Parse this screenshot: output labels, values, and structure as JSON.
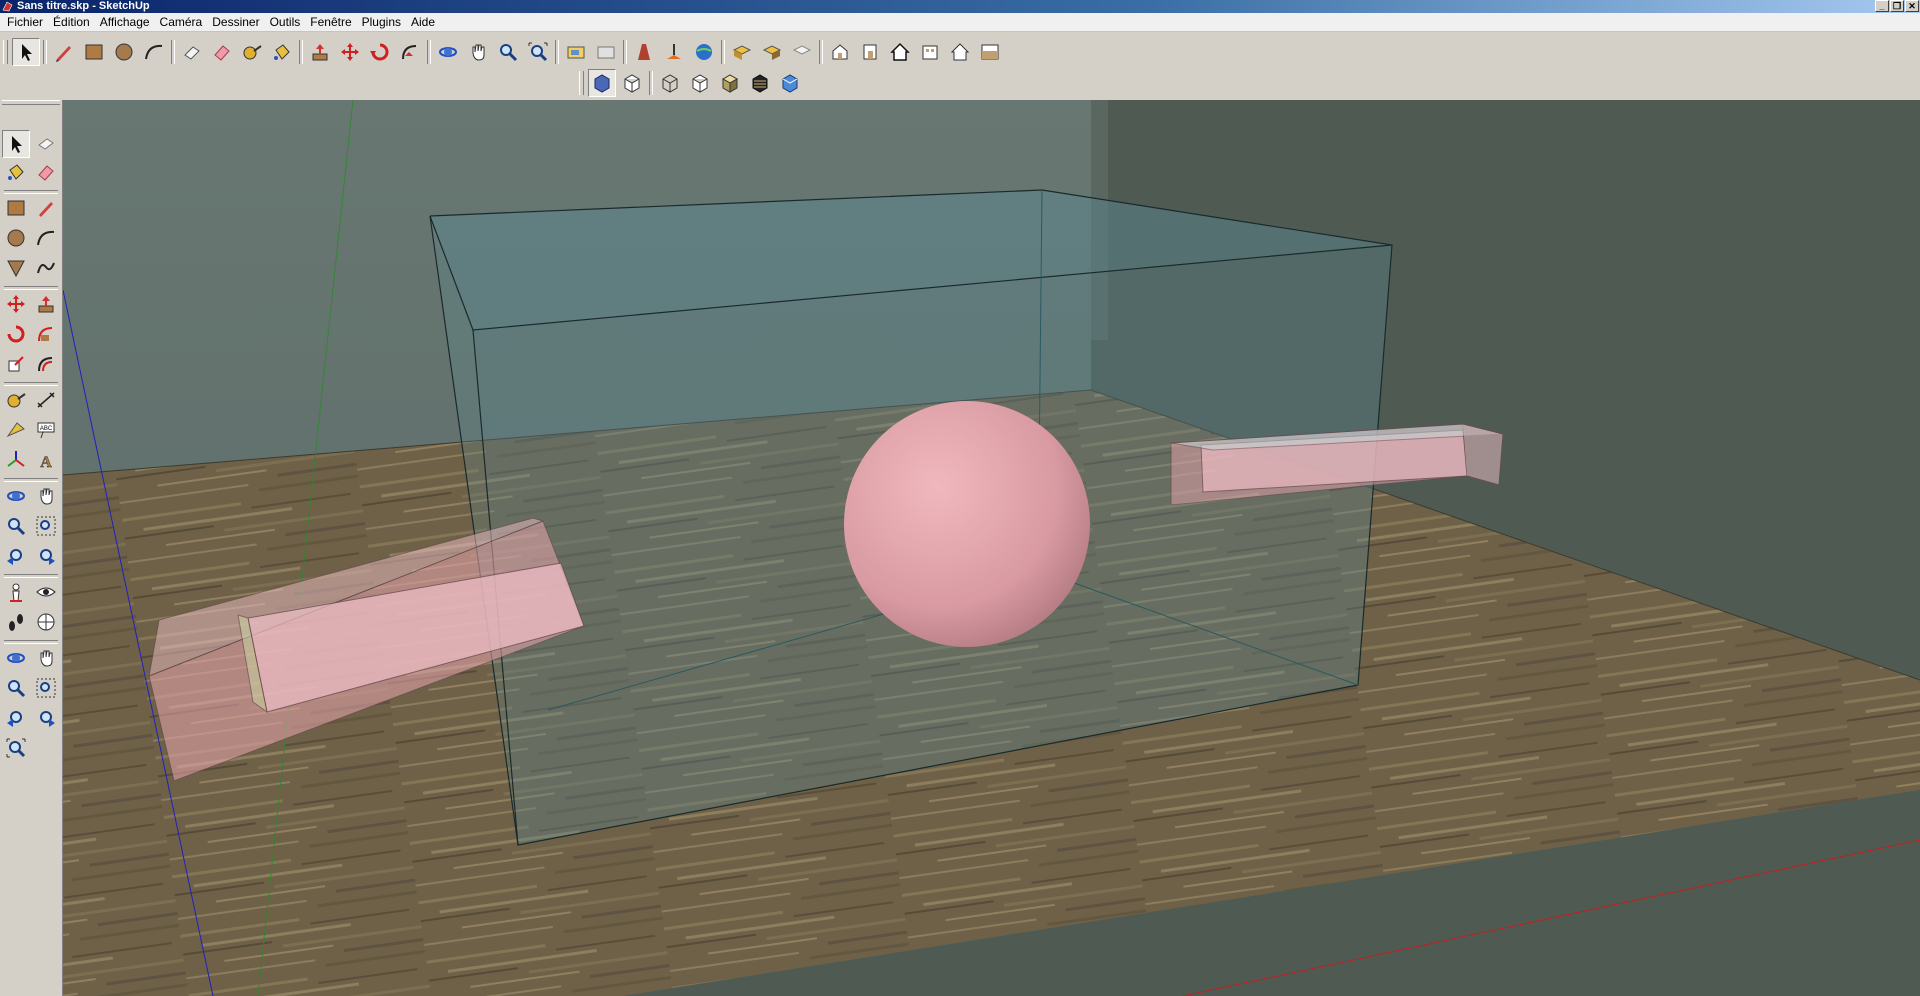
{
  "window": {
    "title": "Sans titre.skp - SketchUp",
    "app_icon": "sketchup-icon",
    "controls": [
      "minimize-icon",
      "restore-icon",
      "close-icon"
    ]
  },
  "menu": {
    "items": [
      "Fichier",
      "Édition",
      "Affichage",
      "Caméra",
      "Dessiner",
      "Outils",
      "Fenêtre",
      "Plugins",
      "Aide"
    ]
  },
  "toolbars": {
    "main": [
      "select-icon",
      "pencil-icon",
      "rectangle-icon",
      "circle-icon",
      "arc-icon",
      "eraser-icon",
      "eraser-pink-icon",
      "tape-measure-icon",
      "paint-bucket-icon",
      "push-pull-icon",
      "move-icon",
      "rotate-icon",
      "follow-me-icon",
      "orbit-icon",
      "pan-icon",
      "zoom-icon",
      "zoom-extents-icon",
      "get-models-icon",
      "share-model-icon",
      "get-current-view-icon",
      "toggle-terrain-icon",
      "add-location-icon",
      "preview-google-earth-icon",
      "components-icon",
      "share-component-icon",
      "3d-warehouse-icon",
      "iso-view-icon",
      "front-view-icon",
      "right-view-icon",
      "back-view-icon",
      "left-view-icon",
      "top-view-icon"
    ],
    "styles": [
      "xray-icon",
      "back-edges-icon",
      "wireframe-icon",
      "hidden-line-icon",
      "shaded-icon",
      "shaded-textures-icon",
      "monochrome-icon"
    ]
  },
  "left_tools": [
    "select-icon",
    "make-component-icon",
    "paint-bucket-icon",
    "eraser-icon",
    "rectangle-icon",
    "line-icon",
    "circle-icon",
    "arc-icon",
    "polygon-icon",
    "freehand-icon",
    "move-icon",
    "push-pull-icon",
    "rotate-icon",
    "follow-me-icon",
    "scale-icon",
    "offset-icon",
    "tape-measure-icon",
    "dimension-icon",
    "protractor-icon",
    "text-icon",
    "axes-icon",
    "3d-text-icon",
    "orbit-icon",
    "pan-icon",
    "zoom-icon",
    "zoom-window-icon",
    "previous-view-icon",
    "next-view-icon",
    "position-camera-icon",
    "look-around-icon",
    "walk-icon",
    "section-plane-icon",
    "orbit-2-icon",
    "pan-2-icon",
    "zoom-2-icon",
    "zoom-window-2-icon",
    "zoom-extents-2-icon",
    "previous-2-icon",
    "zoom-extents-3-icon"
  ],
  "colors": {
    "title_bar": "#0a246a",
    "chrome": "#d4d0c8",
    "sky": "#5e6f6c",
    "ground": "#4f5b52",
    "floor_wood": "#6e6148",
    "glass_box": "#5b8a94",
    "pink_object": "#e8a6ae",
    "axis_blue": "#2020c0",
    "axis_green": "#2a8a2a",
    "axis_red": "#c02020"
  }
}
